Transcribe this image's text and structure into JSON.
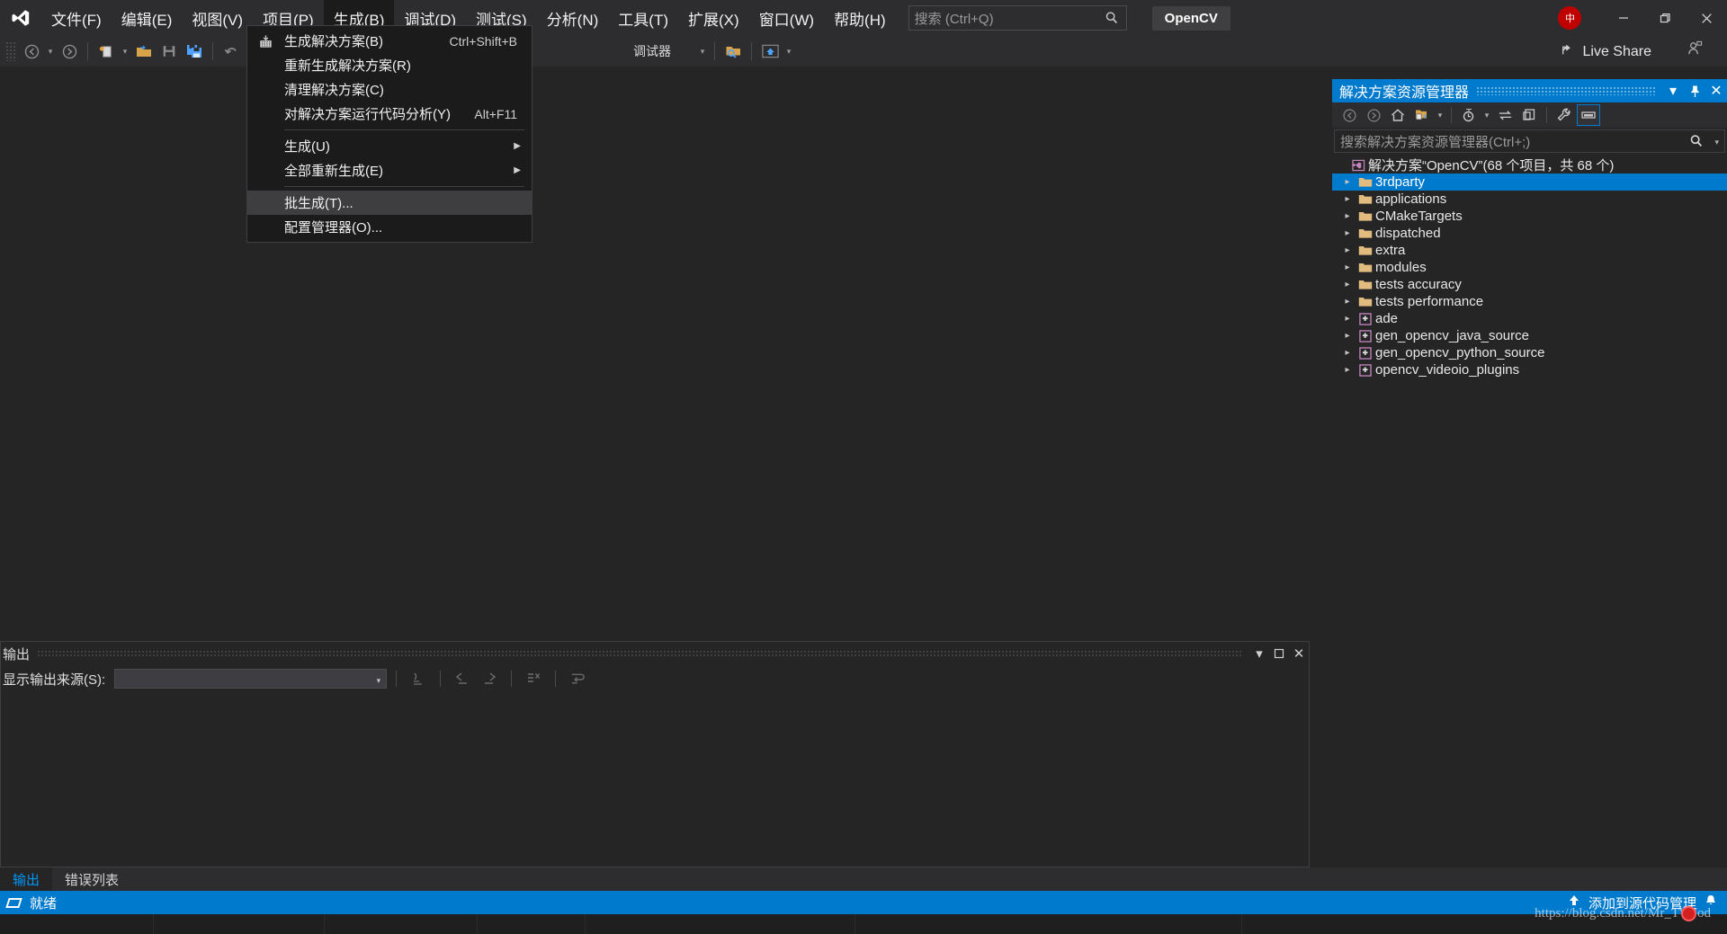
{
  "titlebar": {
    "logo_icon": "visual-studio-logo",
    "menus": [
      {
        "label": "文件(F)",
        "open": false
      },
      {
        "label": "编辑(E)",
        "open": false
      },
      {
        "label": "视图(V)",
        "open": false
      },
      {
        "label": "项目(P)",
        "open": false
      },
      {
        "label": "生成(B)",
        "open": true
      },
      {
        "label": "调试(D)",
        "open": false
      },
      {
        "label": "测试(S)",
        "open": false
      },
      {
        "label": "分析(N)",
        "open": false
      },
      {
        "label": "工具(T)",
        "open": false
      },
      {
        "label": "扩展(X)",
        "open": false
      },
      {
        "label": "窗口(W)",
        "open": false
      },
      {
        "label": "帮助(H)",
        "open": false
      }
    ],
    "search": {
      "placeholder": "搜索 (Ctrl+Q)",
      "value": "",
      "icon": "search-icon"
    },
    "project_name": "OpenCV",
    "ime_badge": "中",
    "window_buttons": {
      "minimize": "minimize-icon",
      "restore": "restore-icon",
      "close": "close-icon"
    }
  },
  "toolbar": {
    "items": [
      {
        "name": "navigate-back-icon",
        "glyph": "back"
      },
      {
        "name": "navigate-forward-icon",
        "glyph": "forward"
      },
      {
        "name": "new-item-icon",
        "glyph": "newitem"
      },
      {
        "name": "open-file-icon",
        "glyph": "openfolder"
      },
      {
        "name": "save-icon",
        "glyph": "save"
      },
      {
        "name": "save-all-icon",
        "glyph": "saveall"
      },
      {
        "name": "undo-icon",
        "glyph": "undo"
      },
      {
        "name": "redo-icon",
        "glyph": "redo"
      }
    ],
    "config_label": "调试器",
    "live_share": {
      "label": "Live Share",
      "icon": "live-share-icon",
      "avatar_icon": "user-avatar-icon"
    }
  },
  "build_menu": {
    "title": "生成(B)",
    "items": [
      {
        "label": "生成解决方案(B)",
        "shortcut": "Ctrl+Shift+B",
        "icon": "build-solution-icon",
        "highlighted": false,
        "submenu": false
      },
      {
        "label": "重新生成解决方案(R)",
        "shortcut": "",
        "icon": "",
        "highlighted": false,
        "submenu": false
      },
      {
        "label": "清理解决方案(C)",
        "shortcut": "",
        "icon": "",
        "highlighted": false,
        "submenu": false
      },
      {
        "label": "对解决方案运行代码分析(Y)",
        "shortcut": "Alt+F11",
        "icon": "",
        "highlighted": false,
        "submenu": false
      },
      {
        "separator": true
      },
      {
        "label": "生成(U)",
        "shortcut": "",
        "icon": "",
        "highlighted": false,
        "submenu": true
      },
      {
        "label": "全部重新生成(E)",
        "shortcut": "",
        "icon": "",
        "highlighted": false,
        "submenu": true
      },
      {
        "separator": true
      },
      {
        "label": "批生成(T)...",
        "shortcut": "",
        "icon": "",
        "highlighted": true,
        "submenu": false
      },
      {
        "label": "配置管理器(O)...",
        "shortcut": "",
        "icon": "",
        "highlighted": false,
        "submenu": false
      }
    ]
  },
  "solution_explorer": {
    "title": "解决方案资源管理器",
    "header_buttons": [
      {
        "name": "panel-dropdown-icon",
        "glyph": "▾"
      },
      {
        "name": "pin-icon",
        "glyph": "pin"
      },
      {
        "name": "close-icon",
        "glyph": "✕"
      }
    ],
    "toolbar": [
      {
        "name": "back-icon",
        "glyph": "back"
      },
      {
        "name": "forward-icon",
        "glyph": "forward"
      },
      {
        "name": "home-icon",
        "glyph": "home"
      },
      {
        "name": "sync-with-active-document-icon",
        "glyph": "syncdoc"
      },
      {
        "name": "pending-changes-filter-icon",
        "glyph": "clock"
      },
      {
        "name": "refresh-icon",
        "glyph": "refresh"
      },
      {
        "name": "show-all-files-icon",
        "glyph": "allfiles"
      },
      {
        "name": "properties-icon",
        "glyph": "wrench"
      },
      {
        "name": "preview-selected-items-icon",
        "glyph": "preview",
        "active": true
      }
    ],
    "search": {
      "placeholder": "搜索解决方案资源管理器(Ctrl+;)",
      "value": "",
      "icon": "search-icon"
    },
    "tree": [
      {
        "label": "解决方案“OpenCV”(68 个项目，共 68 个)",
        "icon": "solution-icon",
        "depth": 0,
        "expandable": false,
        "selected": false
      },
      {
        "label": "3rdparty",
        "icon": "folder-icon",
        "depth": 1,
        "expandable": true,
        "selected": true
      },
      {
        "label": "applications",
        "icon": "folder-icon",
        "depth": 1,
        "expandable": true,
        "selected": false
      },
      {
        "label": "CMakeTargets",
        "icon": "folder-icon",
        "depth": 1,
        "expandable": true,
        "selected": false
      },
      {
        "label": "dispatched",
        "icon": "folder-icon",
        "depth": 1,
        "expandable": true,
        "selected": false
      },
      {
        "label": "extra",
        "icon": "folder-icon",
        "depth": 1,
        "expandable": true,
        "selected": false
      },
      {
        "label": "modules",
        "icon": "folder-icon",
        "depth": 1,
        "expandable": true,
        "selected": false
      },
      {
        "label": "tests accuracy",
        "icon": "folder-icon",
        "depth": 1,
        "expandable": true,
        "selected": false
      },
      {
        "label": "tests performance",
        "icon": "folder-icon",
        "depth": 1,
        "expandable": true,
        "selected": false
      },
      {
        "label": "ade",
        "icon": "project-icon",
        "depth": 1,
        "expandable": true,
        "selected": false
      },
      {
        "label": "gen_opencv_java_source",
        "icon": "project-icon",
        "depth": 1,
        "expandable": true,
        "selected": false
      },
      {
        "label": "gen_opencv_python_source",
        "icon": "project-icon",
        "depth": 1,
        "expandable": true,
        "selected": false
      },
      {
        "label": "opencv_videoio_plugins",
        "icon": "project-icon",
        "depth": 1,
        "expandable": true,
        "selected": false
      }
    ]
  },
  "output_panel": {
    "title": "输出",
    "header_buttons": [
      {
        "name": "panel-dropdown-icon",
        "glyph": "▾"
      },
      {
        "name": "maximize-icon",
        "glyph": "❐"
      },
      {
        "name": "close-icon",
        "glyph": "✕"
      }
    ],
    "source_label": "显示输出来源(S):",
    "source_value": "",
    "toolbar_icons": [
      {
        "name": "find-message-icon"
      },
      {
        "name": "go-to-previous-message-icon"
      },
      {
        "name": "go-to-next-message-icon"
      },
      {
        "name": "clear-all-icon"
      },
      {
        "name": "toggle-word-wrap-icon"
      }
    ],
    "content": ""
  },
  "bottom_tabs": [
    {
      "label": "输出",
      "active": true
    },
    {
      "label": "错误列表",
      "active": false
    }
  ],
  "statusbar": {
    "status_text": "就绪",
    "status_icon": "ready-flag-icon",
    "source_control_text": "添加到源代码管理",
    "source_control_icon": "add-to-source-control-icon",
    "notification_icon": "notification-bell-icon"
  },
  "watermark": {
    "text": "https://blog.csdn.net/Mr_TWJod"
  },
  "colors": {
    "accent": "#007acc",
    "titlebar_bg": "#2d2d30",
    "panel_bg": "#252526",
    "menu_bg": "#1b1b1c",
    "menu_highlight": "#3e3e40",
    "folder": "#e2bb7f",
    "project_icon": "#c586c0",
    "ime_red": "#c00000",
    "text": "#f1f1f1",
    "muted_text": "#9a9a9a"
  }
}
